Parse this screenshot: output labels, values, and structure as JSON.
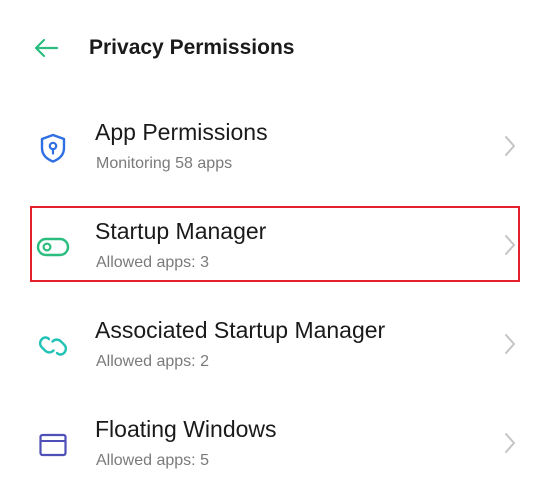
{
  "header": {
    "back_icon": "arrow-left-icon",
    "title": "Privacy Permissions"
  },
  "colors": {
    "accent_green": "#2bbd7e",
    "shield_blue": "#2f6fe4",
    "link_teal": "#21c3b7",
    "window_purple": "#4f4fb8",
    "highlight_red": "#e5202a"
  },
  "items": [
    {
      "icon": "shield-icon",
      "title": "App Permissions",
      "subtitle": "Monitoring 58 apps"
    },
    {
      "icon": "toggle-icon",
      "title": "Startup Manager",
      "subtitle": "Allowed apps: 3"
    },
    {
      "icon": "link-icon",
      "title": "Associated Startup Manager",
      "subtitle": "Allowed apps: 2"
    },
    {
      "icon": "window-icon",
      "title": "Floating Windows",
      "subtitle": "Allowed apps: 5"
    }
  ]
}
